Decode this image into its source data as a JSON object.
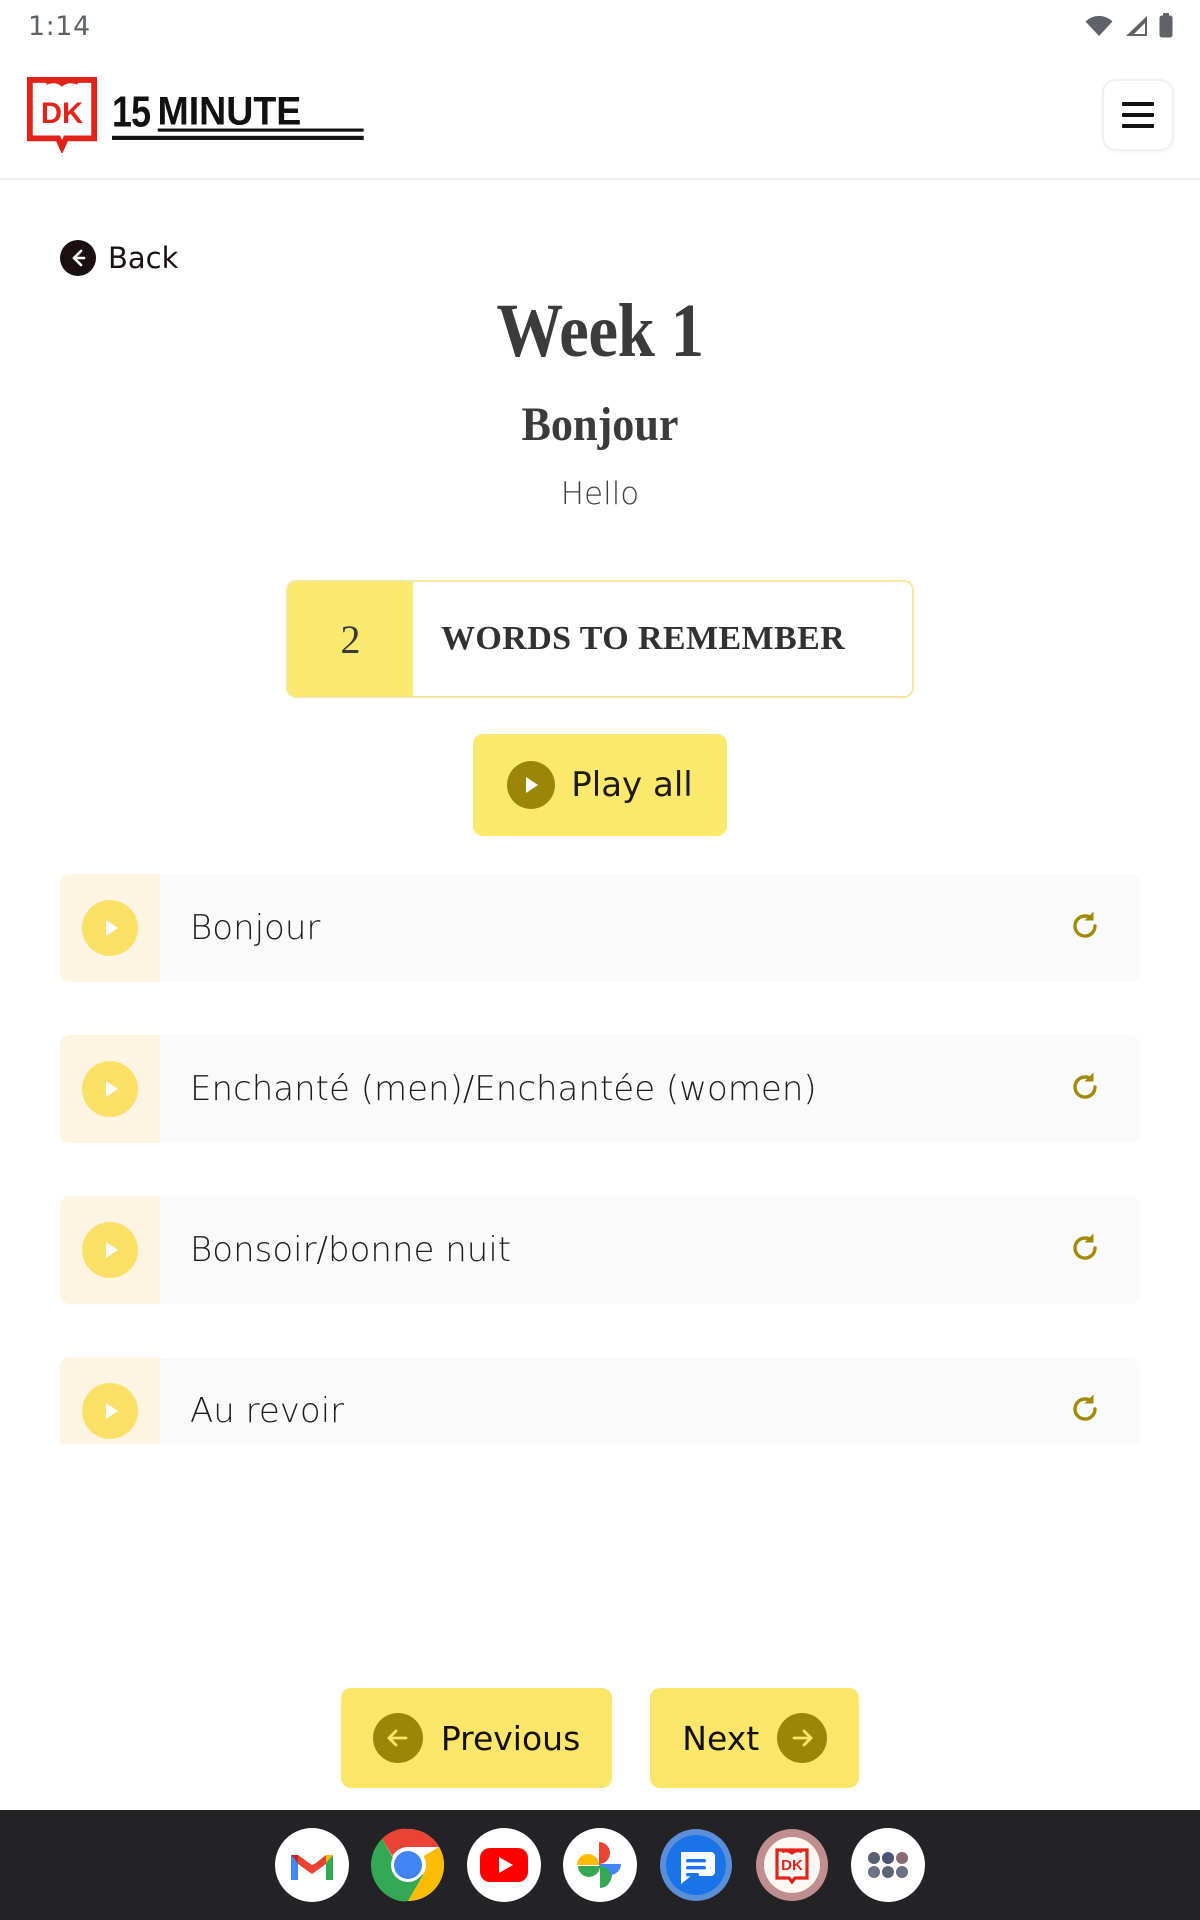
{
  "statusbar": {
    "time": "1:14",
    "icons": [
      "wifi-icon",
      "cellular-signal-icon",
      "battery-icon"
    ]
  },
  "header": {
    "brand_dk": "DK",
    "brand_title": "15 MINUTE",
    "menu_icon": "hamburger-menu-icon"
  },
  "nav": {
    "back_label": "Back",
    "back_icon": "arrow-left-icon"
  },
  "lesson": {
    "title": "Week 1",
    "subtitle": "Bonjour",
    "translation": "Hello"
  },
  "words_to_remember": {
    "count": "2",
    "label": "WORDS TO REMEMBER"
  },
  "play_all": {
    "label": "Play all",
    "icon": "play-icon"
  },
  "words": [
    {
      "text": "Bonjour",
      "play_icon": "play-icon",
      "replay_icon": "replay-icon"
    },
    {
      "text": "Enchanté (men)/Enchantée (women)",
      "play_icon": "play-icon",
      "replay_icon": "replay-icon"
    },
    {
      "text": "Bonsoir/bonne nuit",
      "play_icon": "play-icon",
      "replay_icon": "replay-icon"
    },
    {
      "text": "Au revoir",
      "play_icon": "play-icon",
      "replay_icon": "replay-icon"
    },
    {
      "text": "",
      "play_icon": "play-icon",
      "replay_icon": "replay-icon"
    }
  ],
  "pager": {
    "previous_label": "Previous",
    "previous_icon": "arrow-left-icon",
    "next_label": "Next",
    "next_icon": "arrow-right-icon"
  },
  "dock": {
    "items": [
      {
        "name": "gmail-icon"
      },
      {
        "name": "chrome-icon"
      },
      {
        "name": "youtube-icon"
      },
      {
        "name": "google-photos-icon"
      },
      {
        "name": "google-messages-icon"
      },
      {
        "name": "dk-app-icon"
      },
      {
        "name": "app-drawer-icon"
      }
    ]
  },
  "colors": {
    "accent_yellow": "#fbe66c",
    "accent_gold": "#9b8706",
    "brand_red": "#e2231a",
    "row_bg": "#fafafa",
    "row_left_bg": "#fdf4e2",
    "dock_bg": "#232326"
  }
}
